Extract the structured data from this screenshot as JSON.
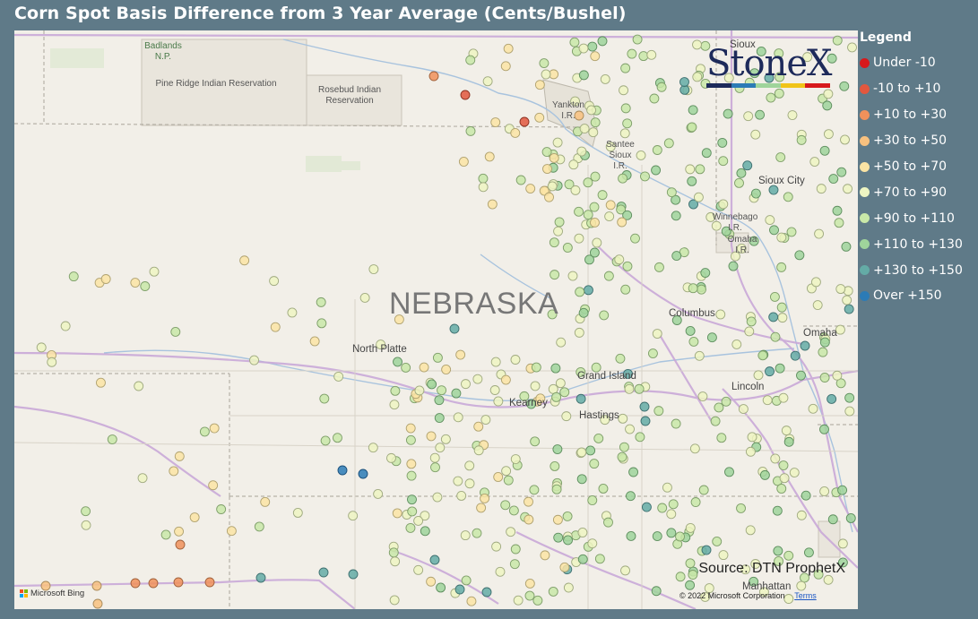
{
  "title": "Corn Spot Basis Difference from 3 Year Average (Cents/Bushel)",
  "legend": {
    "title": "Legend",
    "items": [
      {
        "label": "Under -10",
        "color": "#d7191c"
      },
      {
        "label": "-10 to +10",
        "color": "#e2573e"
      },
      {
        "label": "+10 to +30",
        "color": "#f0915b"
      },
      {
        "label": "+30 to +50",
        "color": "#f8c17f"
      },
      {
        "label": "+50 to +70",
        "color": "#fbe4a4"
      },
      {
        "label": "+70 to +90",
        "color": "#eef5c2"
      },
      {
        "label": "+90 to +110",
        "color": "#c9e8a8"
      },
      {
        "label": "+110 to +130",
        "color": "#9fd49b"
      },
      {
        "label": "+130 to +150",
        "color": "#64aba6"
      },
      {
        "label": "Over +150",
        "color": "#2c7bb6"
      }
    ]
  },
  "map": {
    "state_label": "NEBRASKA",
    "places": {
      "badlands": "Badlands\nN.P.",
      "pine_ridge": "Pine Ridge Indian Reservation",
      "rosebud": "Rosebud Indian\nReservation",
      "yankton": "Yankton\nI.R.",
      "santee": "Santee\nSioux\nI.R.",
      "sioux_city": "Sioux City",
      "winnebago": "Winnebago\nI.R.",
      "omaha_ir": "Omaha\nI.R.",
      "columbus": "Columbus",
      "omaha": "Omaha",
      "north_platte": "North Platte",
      "grand_island": "Grand Island",
      "kearney": "Kearney",
      "hastings": "Hastings",
      "lincoln": "Lincoln",
      "manhattan": "Manhattan",
      "sioux_top": "Sioux"
    },
    "source": "Source: DTN ProphetX",
    "copyright": "© 2022 Microsoft Corporation",
    "terms": "Terms",
    "bing": "Microsoft Bing"
  },
  "logo": {
    "text": "StoneX",
    "bar_colors": [
      "#1d2a5a",
      "#2c7bb6",
      "#9fd49b",
      "#f0c419",
      "#d7191c"
    ]
  }
}
